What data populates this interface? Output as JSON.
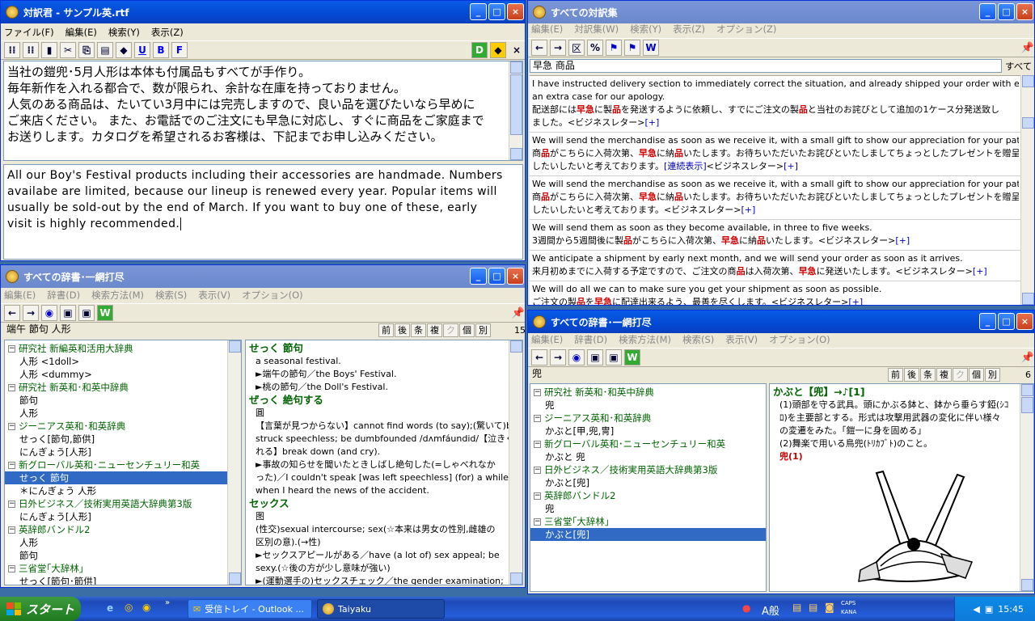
{
  "editor": {
    "title": "対訳君 - サンプル英.rtf",
    "menu": [
      "ファイル(F)",
      "編集(E)",
      "検索(Y)",
      "表示(Z)"
    ],
    "tool_labels": [
      "U",
      "B",
      "F",
      "D"
    ],
    "japanese": [
      "当社の鎧兜･5月人形は本体も付属品もすべてが手作り。",
      "毎年新作を入れる都合で、数が限られ、余計な在庫を持っておりません。",
      "人気のある商品は、たいてい3月中には完売しますので、良い品を選びたいなら早めに",
      "ご来店ください。 また、お電話でのご注文にも早急に対応し、すぐに商品をご家庭まで",
      "お送りします。カタログを希望されるお客様は、下記までお申し込みください。"
    ],
    "english": [
      "All our Boy's Festival products including their accessories are handmade. Numbers",
      "availabe are limited, because our lineup is renewed every year. Popular items will",
      "usually be sold-out by the end of March.  If you want to buy one of these,  early",
      "visit is highly recommended."
    ]
  },
  "corpus": {
    "title": "すべての対訳集",
    "menu": [
      "編集(E)",
      "対訳集(W)",
      "検索(Y)",
      "表示(Z)",
      "オプション(Z)"
    ],
    "percent": "%",
    "kubun": "区",
    "search_value": "早急  商品",
    "all_button": "すべて",
    "entries": [
      {
        "en": "I have instructed delivery section to immediately correct the situation, and already shipped your order with enclosing",
        "en2": "an extra case for our apology.",
        "ja": [
          "配送部には",
          "早急",
          "に製",
          "品",
          "を発送するように依頼し、すでにご注文の製",
          "品",
          "と当社のお詫びとして追加の1ケース分発送致し"
        ],
        "ja2": "ました。<ビジネスレター>",
        "plus": "[+]"
      },
      {
        "en": "We will send the merchandise as soon as we receive it, with a small gift to show our appreciation for your patience.",
        "ja": [
          "商",
          "品",
          "がこちらに入荷次第、",
          "早急",
          "に納",
          "品",
          "いたします。お待ちいただいたお詫びといたしましてちょっとしたプレゼントを贈呈"
        ],
        "ja2": "したいしたいと考えております。",
        "link": "[連続表示]",
        "ja3": "<ビジネスレター>",
        "plus": "[+]"
      },
      {
        "en": "We will send the merchandise as soon as we receive it, with a small gift to show our appreciation for your patience.",
        "ja": [
          "商",
          "品",
          "がこちらに入荷次第、",
          "早急",
          "に納",
          "品",
          "いたします。お待ちいただいたお詫びといたしましてちょっとしたプレゼントを贈呈"
        ],
        "ja2": "したいしたいと考えております。<ビジネスレター>",
        "plus": "[+]"
      },
      {
        "en": "We will send them as soon as they become available, in three to five weeks.",
        "ja": [
          "3週間から5週間後に製",
          "品",
          "がこちらに入荷次第、",
          "早急",
          "に納",
          "品",
          "いたします。<ビジネスレター>"
        ],
        "plus": "[+]"
      },
      {
        "en": "We anticipate a shipment by early next month, and we will send your order as soon as it arrives.",
        "ja": [
          "来月初めまでに入荷する予定ですので、ご注文の商",
          "品",
          "は入荷次第、",
          "早急",
          "に発送いたします。<ビジネスレター>"
        ],
        "plus": "[+]"
      },
      {
        "en": "We will do all we can to make sure you get your shipment as soon as possible.",
        "ja": [
          "ご注文の製",
          "品",
          "を",
          "早急",
          "に配達出来るよう、最善を尽くします。<ビジネスレター>"
        ],
        "plus": "[+]"
      }
    ]
  },
  "dict1": {
    "title": "すべての辞書･一網打尽",
    "menu": [
      "編集(E)",
      "辞書(D)",
      "検索方法(M)",
      "検索(S)",
      "表示(V)",
      "オプション(O)"
    ],
    "search_value": "端午  節句  人形",
    "tabs": [
      "前",
      "後",
      "条",
      "複",
      "ク",
      "個",
      "別"
    ],
    "count": "15",
    "tree": [
      {
        "h": "研究社  新編英和活用大辞典"
      },
      {
        "c": "人形 <1doll>"
      },
      {
        "c": "人形 <dummy>"
      },
      {
        "h": "研究社  新英和･和英中辞典"
      },
      {
        "c": "節句"
      },
      {
        "c": "人形"
      },
      {
        "h": "ジーニアス英和･和英辞典"
      },
      {
        "c": "せっく[節句,節供]"
      },
      {
        "c": "にんぎょう[人形]"
      },
      {
        "h": "新グローバル英和･ニューセンチュリー和英"
      },
      {
        "c": "せっく  節句",
        "sel": true
      },
      {
        "c": "＊にんぎょう  人形"
      },
      {
        "h": "日外ビジネス／技術実用英語大辞典第3版"
      },
      {
        "c": "にんぎょう[人形]"
      },
      {
        "h": "英辞郎バンドル2"
      },
      {
        "c": "人形"
      },
      {
        "c": "節句"
      },
      {
        "h": "三省堂｢大辞林｣"
      },
      {
        "c": "せっく[節句･節供]"
      }
    ],
    "detail": [
      {
        "hw": "せっく  節句"
      },
      {
        "t": "a seasonal festival."
      },
      {
        "t": "►端午の節句／the Boys' Festival."
      },
      {
        "t": "►桃の節句／the Doll's Festival."
      },
      {
        "hw": "ぜっく  絶句する"
      },
      {
        "t": "圓"
      },
      {
        "t": "【言葉が見つからない】cannot find words (to say);(驚いて)be"
      },
      {
        "t": "struck speechless; be dumbfounded /dʌmfáundid/【泣きくず"
      },
      {
        "t": "れる】break down (and cry)."
      },
      {
        "t": "►事故の知らせを聞いたときしばし絶句した(=しゃべれなか"
      },
      {
        "t": "った)／I couldn't speak [was left speechless] (for) a while"
      },
      {
        "t": "when I heard the news of the accident."
      },
      {
        "hw": "セックス"
      },
      {
        "t": "图"
      },
      {
        "t": "(性交)sexual intercourse; sex(☆本来は男女の性別,雌雄の"
      },
      {
        "t": "区別の意).(→性)"
      },
      {
        "t": "►セックスアピールがある／have (a lot of) sex appeal; be"
      },
      {
        "t": "sexy.(☆後の方が少し意味が強い)"
      },
      {
        "t": "►(運動選手の)セックスチェック／the gender examination;"
      }
    ]
  },
  "dict2": {
    "title": "すべての辞書･一網打尽",
    "menu": [
      "編集(E)",
      "辞書(D)",
      "検索方法(M)",
      "検索(S)",
      "表示(V)",
      "オプション(O)"
    ],
    "search_value": "兜",
    "tabs": [
      "前",
      "後",
      "条",
      "複",
      "ク",
      "個",
      "別"
    ],
    "count": "6",
    "tree": [
      {
        "h": "研究社  新英和･和英中辞典"
      },
      {
        "c": "兜"
      },
      {
        "h": "ジーニアス英和･和英辞典"
      },
      {
        "c": "かぶと[甲,兜,冑]"
      },
      {
        "h": "新グローバル英和･ニューセンチュリー和英"
      },
      {
        "c": "かぶと  兜"
      },
      {
        "h": "日外ビジネス／技術実用英語大辞典第3版"
      },
      {
        "c": "かぶと[兜]"
      },
      {
        "h": "英辞郎バンドル2"
      },
      {
        "c": "兜"
      },
      {
        "h": "三省堂｢大辞林｣"
      },
      {
        "c": "かぶと[兜]",
        "sel": true
      }
    ],
    "detail": [
      {
        "hw": "かぶと【兜】→♪[1]"
      },
      {
        "t": "(1)頭部を守る武具。頭にかぶる鉢と、鉢から垂らす錏(ｼｺ"
      },
      {
        "t": "ﾛ)を主要部とする。形式は攻撃用武器の変化に伴い様々"
      },
      {
        "t": "の変遷をみた。「鎧一に身を固める」"
      },
      {
        "t": "(2)舞楽で用いる鳥兜(ﾄﾘｶﾌﾞﾄ)のこと。"
      },
      {
        "red": "兜(1)"
      }
    ]
  },
  "taskbar": {
    "start": "スタート",
    "tasks": [
      "受信トレイ - Outlook ...",
      "Taiyaku"
    ],
    "ime": "A般",
    "caps": "CAPS",
    "kana": "KANA",
    "clock": "15:45"
  }
}
